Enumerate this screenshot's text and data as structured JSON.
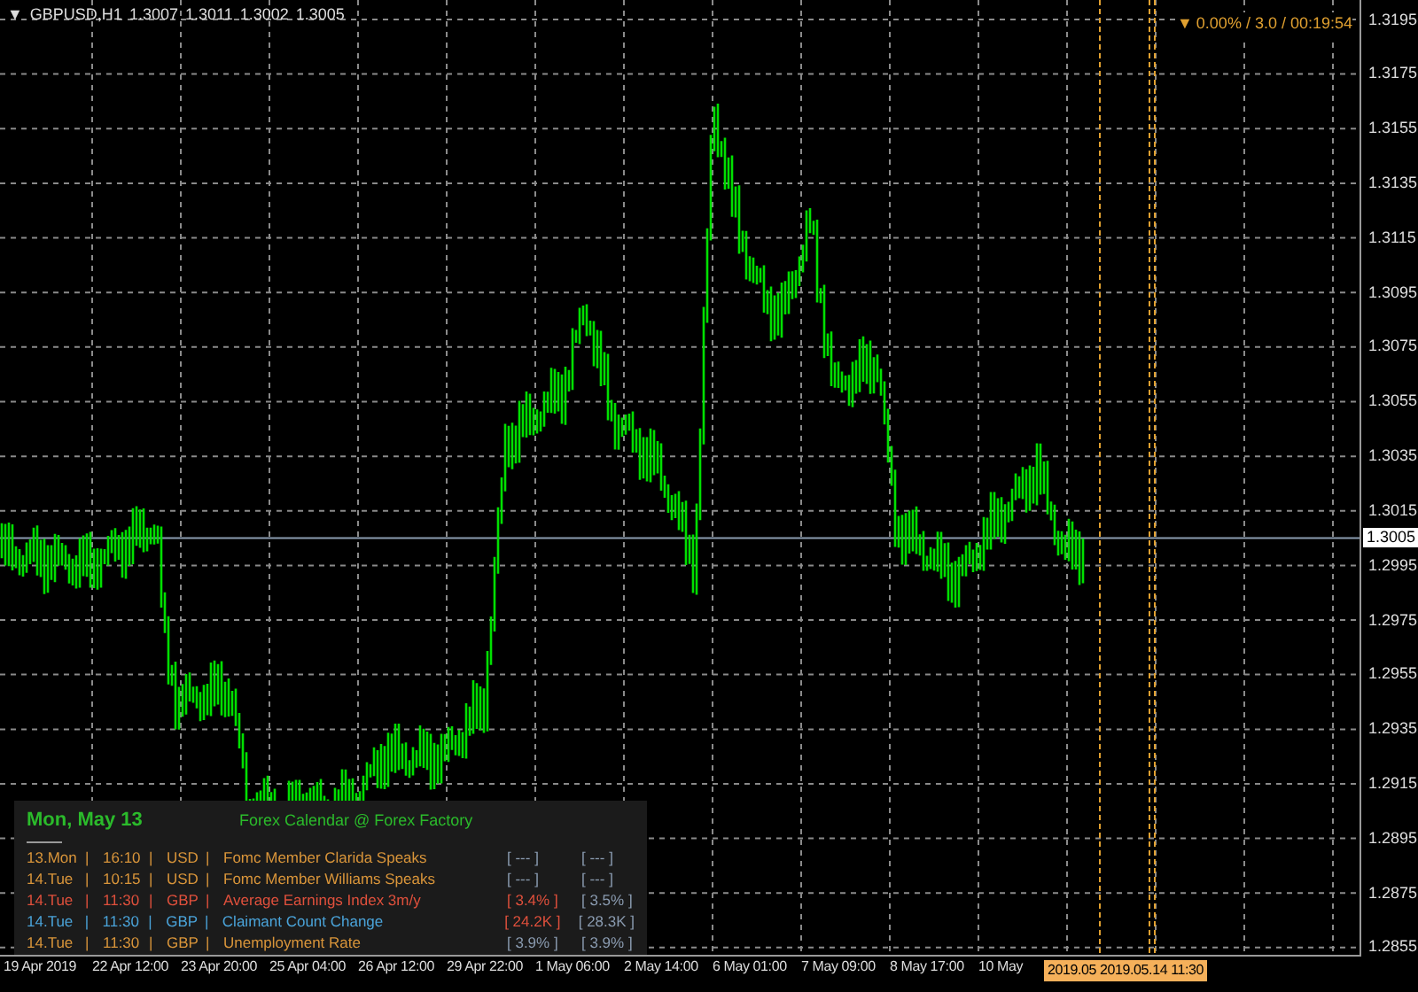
{
  "chart": {
    "menu_glyph": "▼",
    "symbol": "GBPUSD,H1",
    "ohlc": [
      "1.3007",
      "1.3011",
      "1.3002",
      "1.3005"
    ],
    "timer_glyph": "▼",
    "timer": "0.00% / 3.0 / 00:19:54",
    "price_axis": [
      "1.3195",
      "1.3175",
      "1.3155",
      "1.3135",
      "1.3115",
      "1.3095",
      "1.3075",
      "1.3055",
      "1.3035",
      "1.3015",
      "1.2995",
      "1.2975",
      "1.2955",
      "1.2935",
      "1.2915",
      "1.2895",
      "1.2875",
      "1.2855"
    ],
    "current_price": "1.3005",
    "time_axis": [
      "19 Apr 2019",
      "22 Apr 12:00",
      "23 Apr 20:00",
      "25 Apr 04:00",
      "26 Apr 12:00",
      "29 Apr 22:00",
      "1 May 06:00",
      "2 May 14:00",
      "6 May 01:00",
      "7 May 09:00",
      "8 May 17:00",
      "10 May"
    ],
    "cursor_time": [
      "2019.05",
      "2019.05.14 11:30"
    ]
  },
  "calendar": {
    "date": "Mon, May 13",
    "source": "Forex Calendar @ Forex Factory",
    "separator": "|",
    "events": [
      {
        "day": "13.Mon",
        "time": "16:10",
        "currency": "USD",
        "title": "Fomc Member Clarida Speaks",
        "color": "#d9953a",
        "forecast": {
          "text": "[ --- ]",
          "color": "#8a9bb0"
        },
        "previous": "[ --- ]"
      },
      {
        "day": "14.Tue",
        "time": "10:15",
        "currency": "USD",
        "title": "Fomc Member Williams Speaks",
        "color": "#d9953a",
        "forecast": {
          "text": "[ --- ]",
          "color": "#8a9bb0"
        },
        "previous": "[ --- ]"
      },
      {
        "day": "14.Tue",
        "time": "11:30",
        "currency": "GBP",
        "title": "Average Earnings Index 3m/y",
        "color": "#e0503c",
        "forecast": {
          "text": "[ 3.4% ]",
          "color": "#e0503c"
        },
        "previous": "[ 3.5% ]"
      },
      {
        "day": "14.Tue",
        "time": "11:30",
        "currency": "GBP",
        "title": "Claimant Count Change",
        "color": "#4aa3d9",
        "forecast": {
          "text": "[ 24.2K ]",
          "color": "#e0503c"
        },
        "previous": "[ 28.3K ]"
      },
      {
        "day": "14.Tue",
        "time": "11:30",
        "currency": "GBP",
        "title": "Unemployment Rate",
        "color": "#d9953a",
        "forecast": {
          "text": "[ 3.9% ]",
          "color": "#8a9bb0"
        },
        "previous": "[ 3.9% ]"
      }
    ]
  }
}
